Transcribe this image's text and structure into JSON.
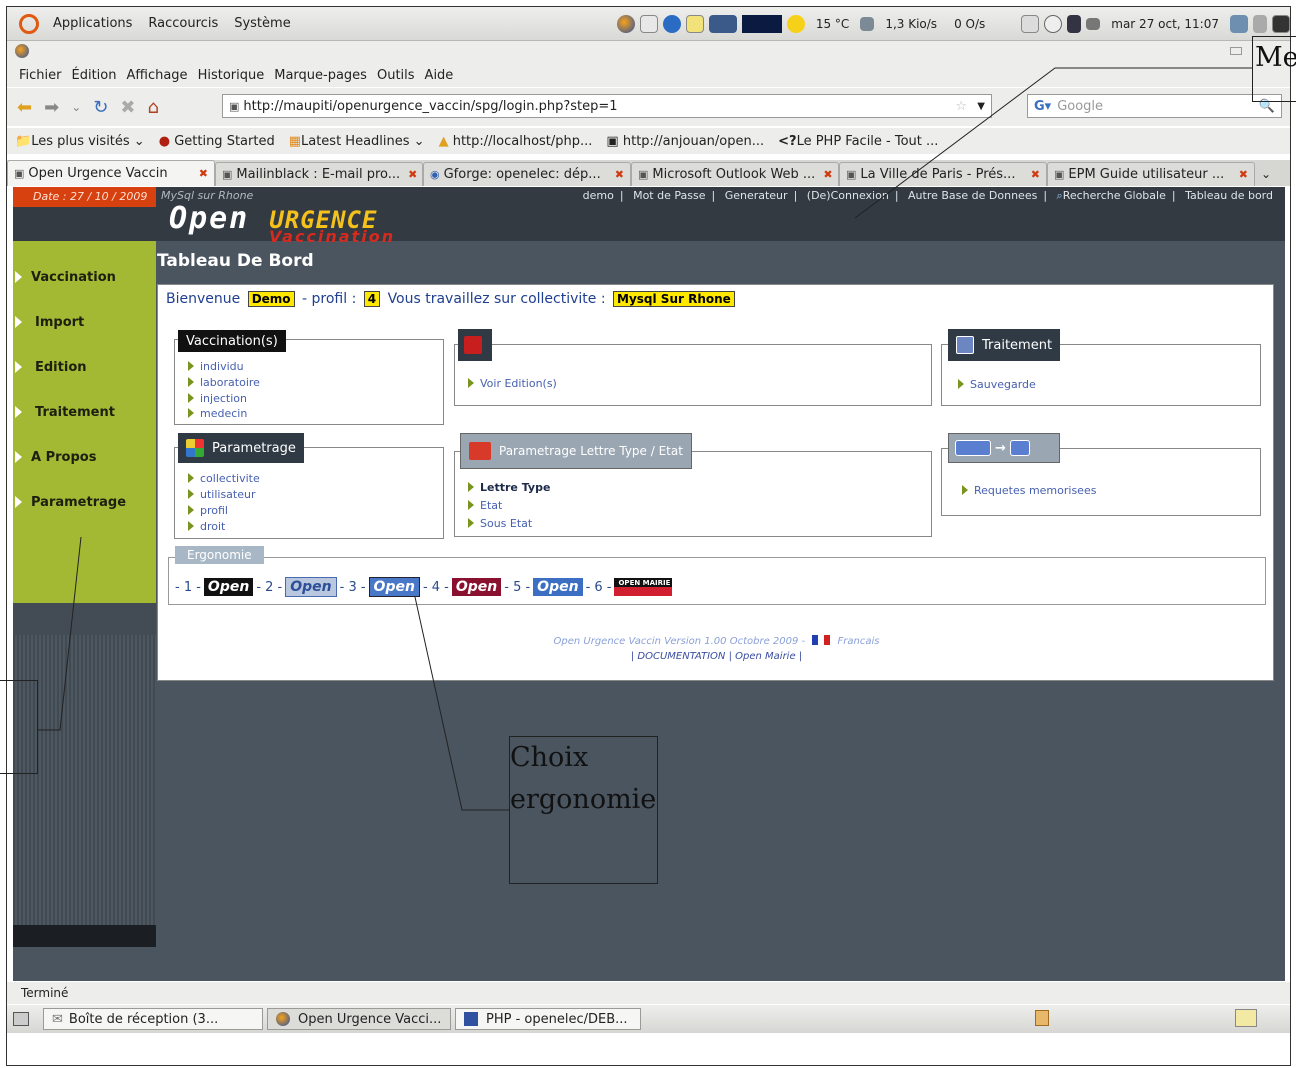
{
  "gnome_panel": {
    "menus": [
      "Applications",
      "Raccourcis",
      "Système"
    ],
    "weather": "15 °C",
    "network_down": "1,3 Kio/s",
    "network_up": "0 O/s",
    "clock": "mar 27 oct, 11:07"
  },
  "firefox": {
    "menubar": [
      "Fichier",
      "Édition",
      "Affichage",
      "Historique",
      "Marque-pages",
      "Outils",
      "Aide"
    ],
    "url": "http://maupiti/openurgence_vaccin/spg/login.php?step=1",
    "search_placeholder": "Google",
    "bookmarks": [
      "Les plus visités",
      "Getting Started",
      "Latest Headlines",
      "http://localhost/php...",
      "http://anjouan/open...",
      "Le PHP Facile - Tout ..."
    ],
    "tabs": [
      {
        "label": "Open Urgence Vaccin",
        "active": true
      },
      {
        "label": "Mailinblack : E-mail pro...",
        "active": false
      },
      {
        "label": "Gforge: openelec: dép...",
        "active": false
      },
      {
        "label": "Microsoft Outlook Web ...",
        "active": false
      },
      {
        "label": "La Ville de Paris - Prés...",
        "active": false
      },
      {
        "label": "EPM Guide utilisateur ...",
        "active": false
      }
    ],
    "status": "Terminé"
  },
  "app": {
    "date_label": "Date : 27 / 10 / 2009",
    "base_label": "MySql sur Rhone",
    "top_links": [
      "demo",
      "Mot de Passe",
      "Generateur",
      "(De)Connexion",
      "Autre Base de Donnees",
      "Recherche Globale",
      "Tableau de bord"
    ],
    "logo_open": "Open",
    "logo_urgence": "URGENCE",
    "logo_vaccination": "Vaccination",
    "sidebar": [
      "Vaccination",
      "Import",
      "Edition",
      "Traitement",
      "A Propos",
      "Parametrage"
    ],
    "page_title": "Tableau De Bord",
    "welcome": {
      "bienvenue": "Bienvenue",
      "user": "Demo",
      "profil_label": "- profil :",
      "profil": "4",
      "travail": "Vous travaillez sur  collectivite :",
      "collectivite": "Mysql Sur Rhone"
    },
    "panels": {
      "vaccination": {
        "title": "Vaccination(s)",
        "links": [
          "individu",
          "laboratoire",
          "injection",
          "medecin"
        ]
      },
      "edition": {
        "links": [
          "Voir  Edition(s)"
        ]
      },
      "traitement": {
        "title": "Traitement",
        "links": [
          "Sauvegarde"
        ]
      },
      "parametrage": {
        "title": "Parametrage",
        "links": [
          "collectivite",
          "utilisateur",
          "profil",
          "droit"
        ]
      },
      "lettre": {
        "title": "Parametrage Lettre Type / Etat",
        "links": [
          "Lettre Type",
          "Etat",
          "Sous Etat"
        ]
      },
      "requetes": {
        "links": [
          "Requetes memorisees"
        ]
      }
    },
    "ergonomie": {
      "label": "Ergonomie",
      "items": [
        {
          "num": "- 1 -",
          "text": "Open"
        },
        {
          "num": "- 2 -",
          "text": "Open"
        },
        {
          "num": "- 3 -",
          "text": "Open"
        },
        {
          "num": "- 4 -",
          "text": "Open"
        },
        {
          "num": "- 5 -",
          "text": "Open"
        },
        {
          "num": "- 6 -",
          "text": "OPEN MAIRIE"
        }
      ]
    },
    "footer": {
      "version": "Open Urgence Vaccin  Version 1.00 Octobre 2009 -",
      "language": "Francais",
      "documentation": "DOCUMENTATION",
      "openmairie": "Open Mairie"
    }
  },
  "taskbar": [
    "Boîte de réception (3...",
    "Open Urgence Vacci...",
    "PHP - openelec/DEB..."
  ],
  "annotations": {
    "header": "Me",
    "ergonomie": "Choix ergonomie"
  }
}
